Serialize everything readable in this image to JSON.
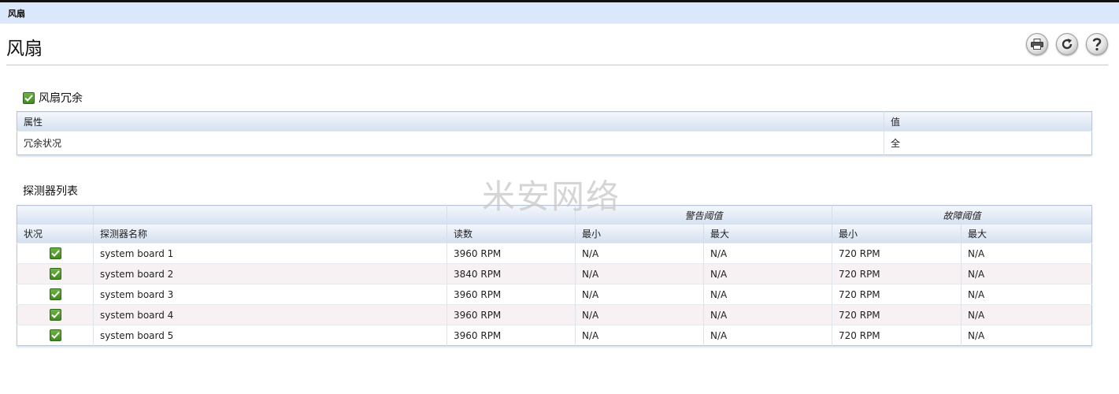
{
  "window": {
    "title": "风扇"
  },
  "page": {
    "title": "风扇"
  },
  "toolbar": {
    "icons": [
      "print-icon",
      "refresh-icon",
      "help-icon"
    ]
  },
  "redundancy": {
    "heading": "风扇冗余",
    "status_icon": "check-icon",
    "columns": [
      "属性",
      "值"
    ],
    "rows": [
      {
        "property": "冗余状况",
        "value": "全"
      }
    ]
  },
  "probes": {
    "heading": "探测器列表",
    "group_headers": {
      "warning": "警告阈值",
      "failure": "故障阈值"
    },
    "columns": [
      "状况",
      "探测器名称",
      "读数",
      "最小",
      "最大",
      "最小",
      "最大"
    ],
    "rows": [
      {
        "status": "ok",
        "name": "system board 1",
        "reading": "3960 RPM",
        "warn_min": "N/A",
        "warn_max": "N/A",
        "fail_min": "720 RPM",
        "fail_max": "N/A"
      },
      {
        "status": "ok",
        "name": "system board 2",
        "reading": "3840 RPM",
        "warn_min": "N/A",
        "warn_max": "N/A",
        "fail_min": "720 RPM",
        "fail_max": "N/A"
      },
      {
        "status": "ok",
        "name": "system board 3",
        "reading": "3960 RPM",
        "warn_min": "N/A",
        "warn_max": "N/A",
        "fail_min": "720 RPM",
        "fail_max": "N/A"
      },
      {
        "status": "ok",
        "name": "system board 4",
        "reading": "3960 RPM",
        "warn_min": "N/A",
        "warn_max": "N/A",
        "fail_min": "720 RPM",
        "fail_max": "N/A"
      },
      {
        "status": "ok",
        "name": "system board 5",
        "reading": "3960 RPM",
        "warn_min": "N/A",
        "warn_max": "N/A",
        "fail_min": "720 RPM",
        "fail_max": "N/A"
      }
    ]
  },
  "watermark": "米安网络",
  "colors": {
    "ok": "#4a9a2a",
    "header_bg": "#d4e0f0",
    "topbar_bg": "#dbe7fb",
    "row_alt": "#f7f1f3"
  }
}
